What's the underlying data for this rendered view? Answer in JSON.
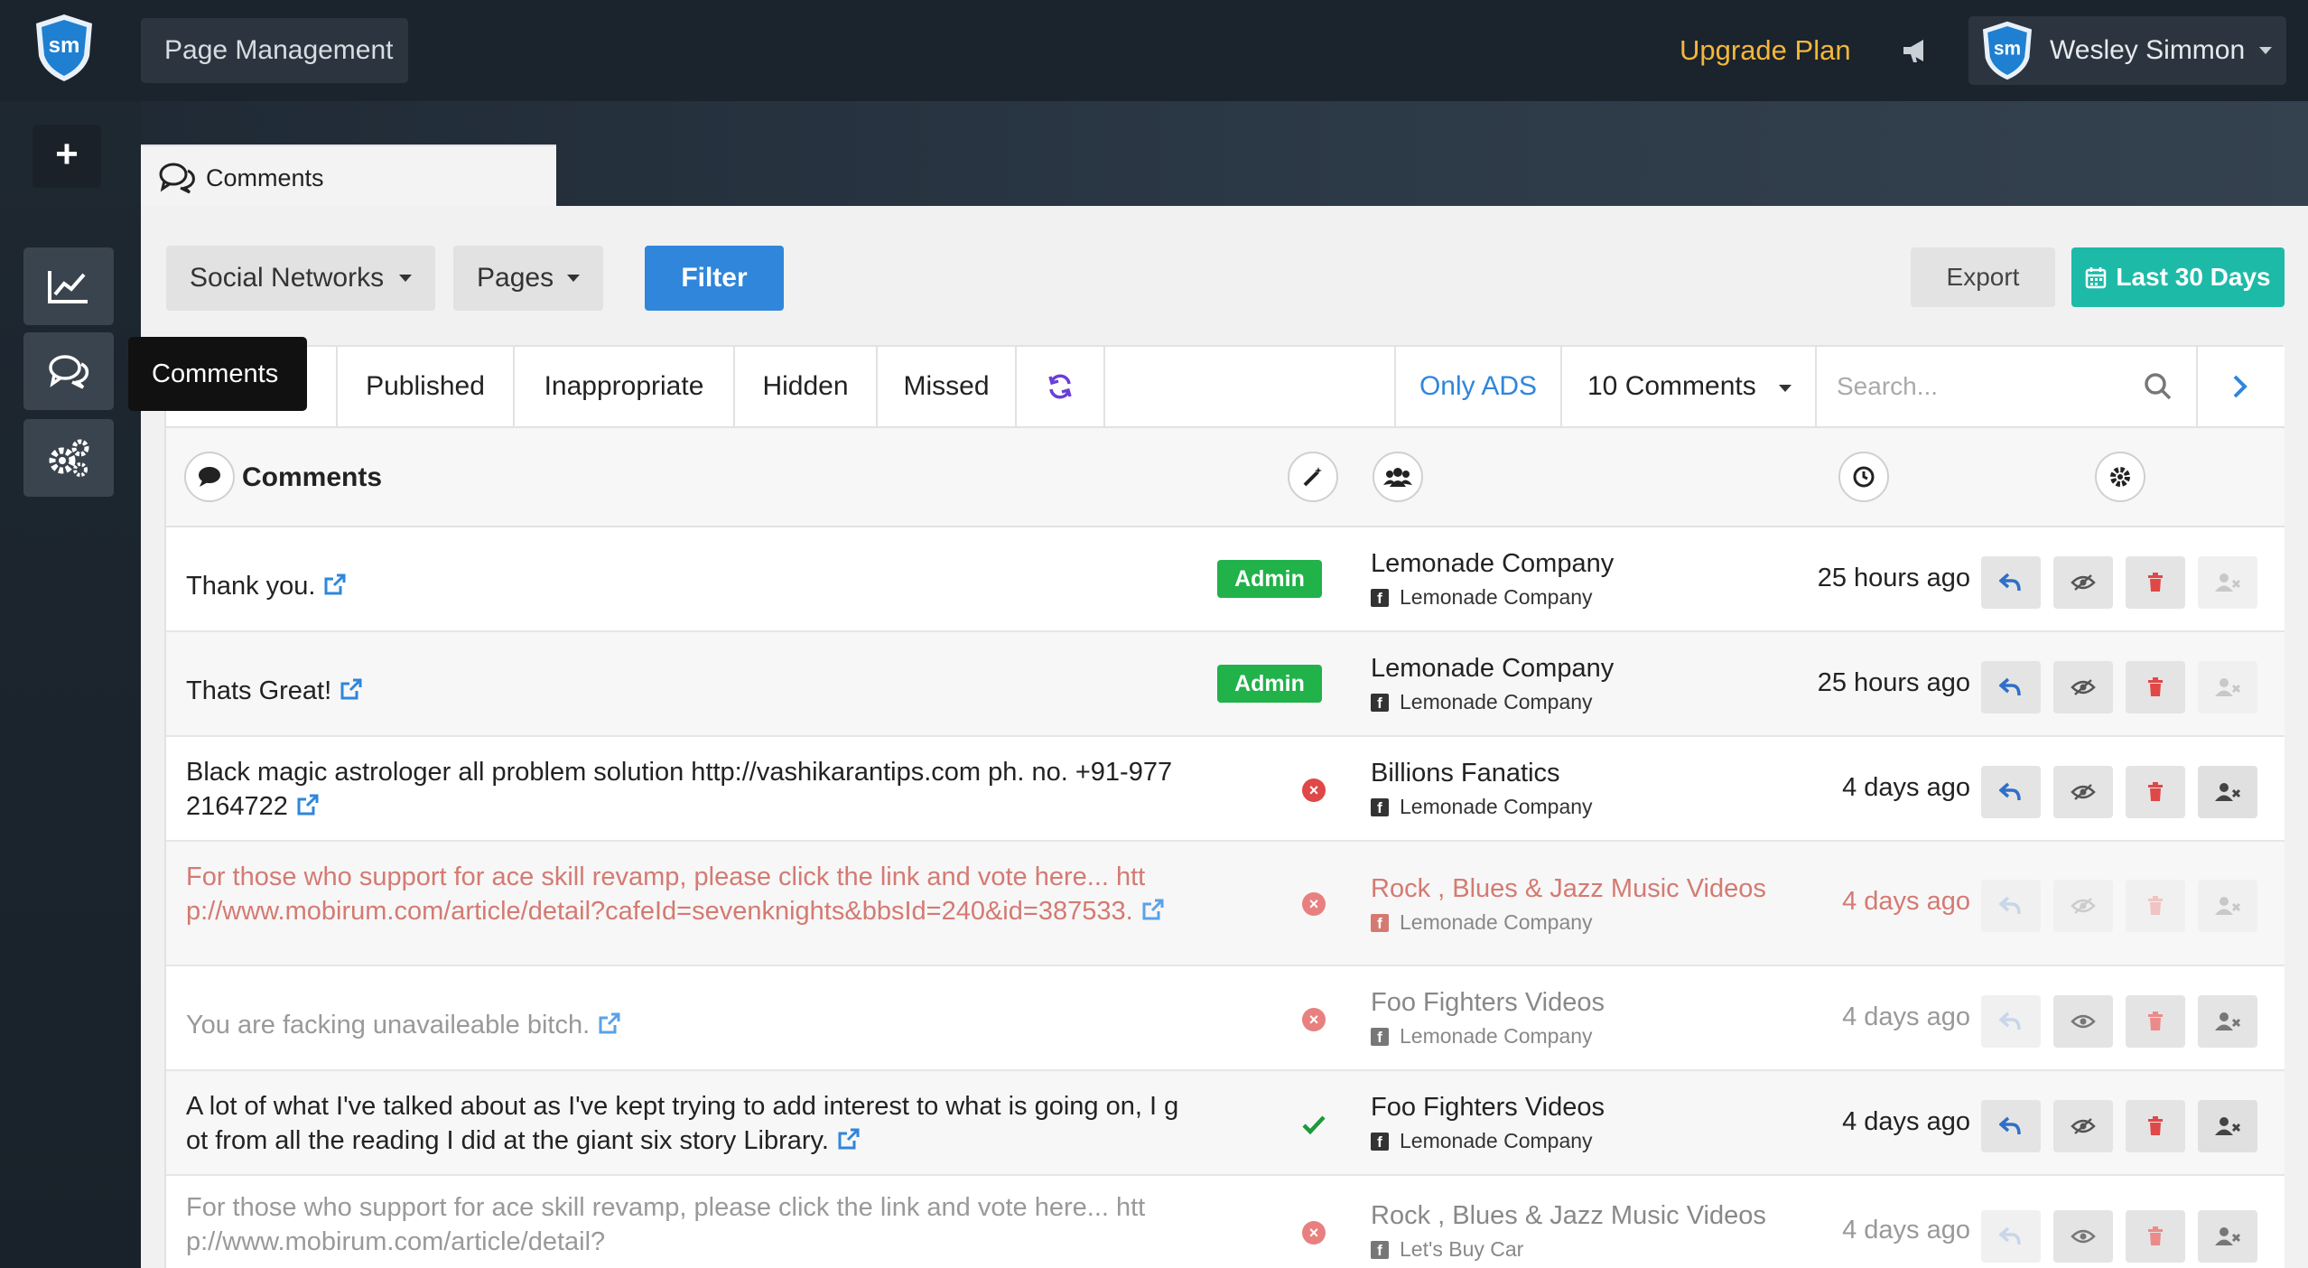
{
  "topbar": {
    "logo_text": "sm",
    "page_management": "Page Management",
    "upgrade": "Upgrade Plan",
    "user_name": "Wesley Simmon"
  },
  "sidebar": {
    "add_label": "+",
    "tooltip": "Comments"
  },
  "main_tab": {
    "label": "Comments"
  },
  "filters": {
    "social_networks": "Social Networks",
    "pages": "Pages",
    "filter": "Filter",
    "export": "Export",
    "last_30_days": "Last 30 Days"
  },
  "tabs": {
    "first_visible": "l",
    "published": "Published",
    "inappropriate": "Inappropriate",
    "hidden": "Hidden",
    "missed": "Missed",
    "only_ads": "Only ADS",
    "comment_count": "10 Comments",
    "search_placeholder": "Search..."
  },
  "table_header": {
    "comments": "Comments"
  },
  "colors": {
    "accent_blue": "#2f86db",
    "teal": "#1ebaa8",
    "admin_green": "#21b24a",
    "upgrade_yellow": "#f3b73b",
    "danger_red": "#e04747"
  },
  "rows": [
    {
      "text": "Thank you.",
      "badge": "Admin",
      "page": "Lemonade Company",
      "account": "Lemonade Company",
      "time": "25 hours ago"
    },
    {
      "text": "Thats Great!",
      "badge": "Admin",
      "page": "Lemonade Company",
      "account": "Lemonade Company",
      "time": "25 hours ago"
    },
    {
      "text": "Black magic astrologer all problem solution http://vashikarantips.com ph. no. +91-9772164722",
      "status": "x",
      "page": "Billions Fanatics",
      "account": "Lemonade Company",
      "time": "4 days ago"
    },
    {
      "text": "For those who support for ace skill revamp, please click the link and vote here... http://www.mobirum.com/article/detail?cafeId=sevenknights&bbsId=240&id=387533.",
      "status": "x",
      "page": "Rock , Blues & Jazz Music Videos",
      "account": "Lemonade Company",
      "time": "4 days ago"
    },
    {
      "text": "You are facking unavaileable bitch.",
      "status": "x",
      "page": "Foo Fighters Videos",
      "account": "Lemonade Company",
      "time": "4 days ago"
    },
    {
      "text": "A lot of what I've talked about as I've kept trying to add interest to what is going on, I got from all the reading I did at the giant six story Library.",
      "status": "check",
      "page": "Foo Fighters Videos",
      "account": "Lemonade Company",
      "time": "4 days ago"
    },
    {
      "text": "For those who support for ace skill revamp, please click the link and vote here... http://www.mobirum.com/article/detail?",
      "status": "x",
      "page": "Rock , Blues & Jazz Music Videos",
      "account": "Let's Buy Car",
      "time": "4 days ago"
    }
  ]
}
